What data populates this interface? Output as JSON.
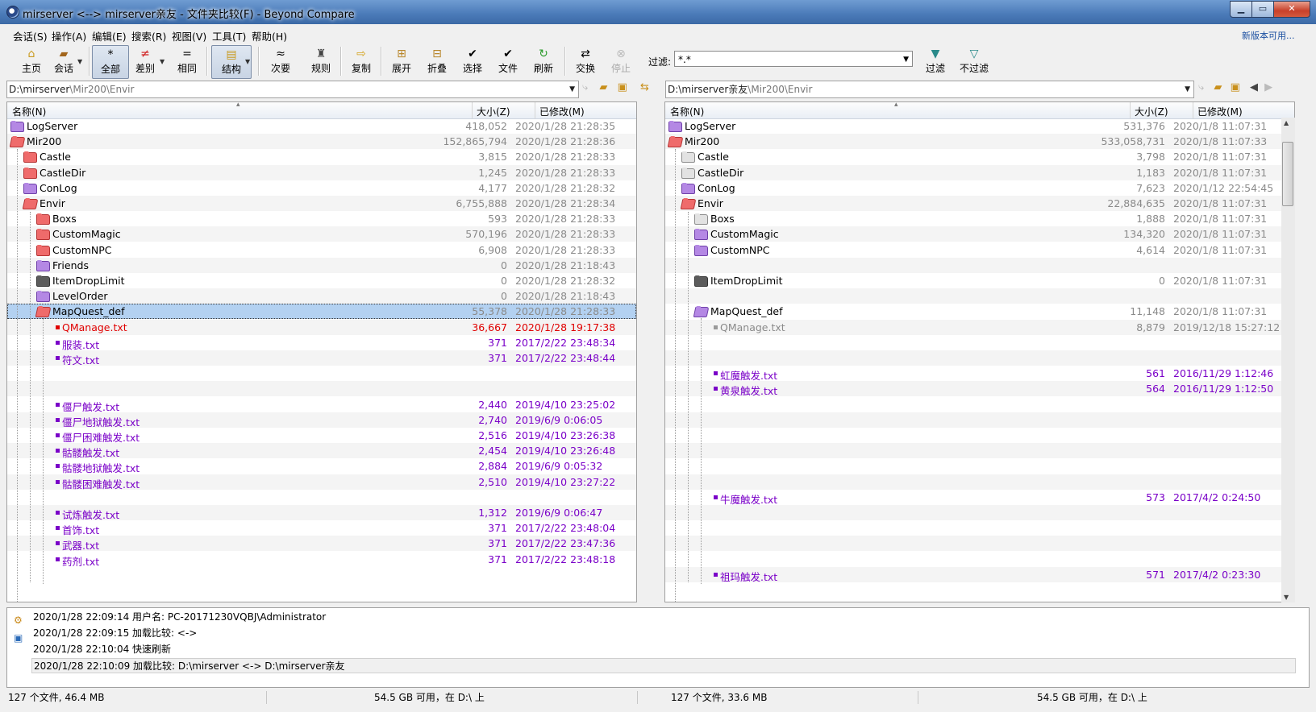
{
  "window": {
    "title": "mirserver <--> mirserver亲友 - 文件夹比较(F) - Beyond Compare"
  },
  "menu": [
    "会话(S)",
    "操作(A)",
    "编辑(E)",
    "搜索(R)",
    "视图(V)",
    "工具(T)",
    "帮助(H)"
  ],
  "new_version": "新版本可用...",
  "toolbar": {
    "home": "主页",
    "session": "会话",
    "all": "全部",
    "diff": "差别",
    "same": "相同",
    "structure": "结构",
    "minor": "次要",
    "rules": "规则",
    "copy": "复制",
    "expand": "展开",
    "collapse": "折叠",
    "select": "选择",
    "files": "文件",
    "refresh": "刷新",
    "swap": "交换",
    "stop": "停止",
    "filter_label": "过滤:",
    "filter_value": "*.*",
    "filter": "过滤",
    "no_filter": "不过滤"
  },
  "left": {
    "path_base": "D:\\mirserver",
    "path_rest": "\\Mir200\\Envir",
    "columns": {
      "name": "名称(N)",
      "size": "大小(Z)",
      "modified": "已修改(M)"
    },
    "rows": [
      {
        "name": "LogServer",
        "size": "418,052",
        "date": "2020/1/28 21:28:35"
      },
      {
        "name": "Mir200",
        "size": "152,865,794",
        "date": "2020/1/28 21:28:36"
      },
      {
        "name": "Castle",
        "size": "3,815",
        "date": "2020/1/28 21:28:33"
      },
      {
        "name": "CastleDir",
        "size": "1,245",
        "date": "2020/1/28 21:28:33"
      },
      {
        "name": "ConLog",
        "size": "4,177",
        "date": "2020/1/28 21:28:32"
      },
      {
        "name": "Envir",
        "size": "6,755,888",
        "date": "2020/1/28 21:28:34"
      },
      {
        "name": "Boxs",
        "size": "593",
        "date": "2020/1/28 21:28:33"
      },
      {
        "name": "CustomMagic",
        "size": "570,196",
        "date": "2020/1/28 21:28:33"
      },
      {
        "name": "CustomNPC",
        "size": "6,908",
        "date": "2020/1/28 21:28:33"
      },
      {
        "name": "Friends",
        "size": "0",
        "date": "2020/1/28 21:18:43"
      },
      {
        "name": "ItemDropLimit",
        "size": "0",
        "date": "2020/1/28 21:28:32"
      },
      {
        "name": "LevelOrder",
        "size": "0",
        "date": "2020/1/28 21:18:43"
      },
      {
        "name": "MapQuest_def",
        "size": "55,378",
        "date": "2020/1/28 21:28:33"
      },
      {
        "name": "QManage.txt",
        "size": "36,667",
        "date": "2020/1/28 19:17:38"
      },
      {
        "name": "服装.txt",
        "size": "371",
        "date": "2017/2/22 23:48:34"
      },
      {
        "name": "符文.txt",
        "size": "371",
        "date": "2017/2/22 23:48:44"
      },
      {
        "name": "",
        "size": "",
        "date": ""
      },
      {
        "name": "",
        "size": "",
        "date": ""
      },
      {
        "name": "僵尸触发.txt",
        "size": "2,440",
        "date": "2019/4/10 23:25:02"
      },
      {
        "name": "僵尸地狱触发.txt",
        "size": "2,740",
        "date": "2019/6/9 0:06:05"
      },
      {
        "name": "僵尸困难触发.txt",
        "size": "2,516",
        "date": "2019/4/10 23:26:38"
      },
      {
        "name": "骷髅触发.txt",
        "size": "2,454",
        "date": "2019/4/10 23:26:48"
      },
      {
        "name": "骷髅地狱触发.txt",
        "size": "2,884",
        "date": "2019/6/9 0:05:32"
      },
      {
        "name": "骷髅困难触发.txt",
        "size": "2,510",
        "date": "2019/4/10 23:27:22"
      },
      {
        "name": "",
        "size": "",
        "date": ""
      },
      {
        "name": "试炼触发.txt",
        "size": "1,312",
        "date": "2019/6/9 0:06:47"
      },
      {
        "name": "首饰.txt",
        "size": "371",
        "date": "2017/2/22 23:48:04"
      },
      {
        "name": "武器.txt",
        "size": "371",
        "date": "2017/2/22 23:47:36"
      },
      {
        "name": "药剂.txt",
        "size": "371",
        "date": "2017/2/22 23:48:18"
      }
    ],
    "status_files": "127 个文件, 46.4 MB",
    "status_free": "54.5 GB 可用，在 D:\\ 上"
  },
  "right": {
    "path_base": "D:\\mirserver亲友",
    "path_rest": "\\Mir200\\Envir",
    "columns": {
      "name": "名称(N)",
      "size": "大小(Z)",
      "modified": "已修改(M)"
    },
    "rows": [
      {
        "name": "LogServer",
        "size": "531,376",
        "date": "2020/1/8 11:07:31"
      },
      {
        "name": "Mir200",
        "size": "533,058,731",
        "date": "2020/1/8 11:07:33"
      },
      {
        "name": "Castle",
        "size": "3,798",
        "date": "2020/1/8 11:07:31"
      },
      {
        "name": "CastleDir",
        "size": "1,183",
        "date": "2020/1/8 11:07:31"
      },
      {
        "name": "ConLog",
        "size": "7,623",
        "date": "2020/1/12 22:54:45"
      },
      {
        "name": "Envir",
        "size": "22,884,635",
        "date": "2020/1/8 11:07:31"
      },
      {
        "name": "Boxs",
        "size": "1,888",
        "date": "2020/1/8 11:07:31"
      },
      {
        "name": "CustomMagic",
        "size": "134,320",
        "date": "2020/1/8 11:07:31"
      },
      {
        "name": "CustomNPC",
        "size": "4,614",
        "date": "2020/1/8 11:07:31"
      },
      {
        "name": "",
        "size": "",
        "date": ""
      },
      {
        "name": "ItemDropLimit",
        "size": "0",
        "date": "2020/1/8 11:07:31"
      },
      {
        "name": "",
        "size": "",
        "date": ""
      },
      {
        "name": "MapQuest_def",
        "size": "11,148",
        "date": "2020/1/8 11:07:31"
      },
      {
        "name": "QManage.txt",
        "size": "8,879",
        "date": "2019/12/18 15:27:12"
      },
      {
        "name": "",
        "size": "",
        "date": ""
      },
      {
        "name": "",
        "size": "",
        "date": ""
      },
      {
        "name": "虹魔触发.txt",
        "size": "561",
        "date": "2016/11/29 1:12:46"
      },
      {
        "name": "黄泉触发.txt",
        "size": "564",
        "date": "2016/11/29 1:12:50"
      },
      {
        "name": "",
        "size": "",
        "date": ""
      },
      {
        "name": "",
        "size": "",
        "date": ""
      },
      {
        "name": "",
        "size": "",
        "date": ""
      },
      {
        "name": "",
        "size": "",
        "date": ""
      },
      {
        "name": "",
        "size": "",
        "date": ""
      },
      {
        "name": "",
        "size": "",
        "date": ""
      },
      {
        "name": "牛魔触发.txt",
        "size": "573",
        "date": "2017/4/2 0:24:50"
      },
      {
        "name": "",
        "size": "",
        "date": ""
      },
      {
        "name": "",
        "size": "",
        "date": ""
      },
      {
        "name": "",
        "size": "",
        "date": ""
      },
      {
        "name": "",
        "size": "",
        "date": ""
      },
      {
        "name": "祖玛触发.txt",
        "size": "571",
        "date": "2017/4/2 0:23:30"
      }
    ],
    "status_files": "127 个文件, 33.6 MB",
    "status_free": "54.5 GB 可用，在 D:\\ 上"
  },
  "log": [
    "2020/1/28 22:09:14  用户名: PC-20171230VQBJ\\Administrator",
    "2020/1/28 22:09:15  加载比较:  <->",
    "2020/1/28 22:10:04  快速刷新",
    "2020/1/28 22:10:09  加载比较: D:\\mirserver <-> D:\\mirserver亲友"
  ],
  "colors": {
    "different": "#e00000",
    "orphan": "#7a00c8",
    "same": "#8a8a8a",
    "selection": "#b3d1f1"
  }
}
